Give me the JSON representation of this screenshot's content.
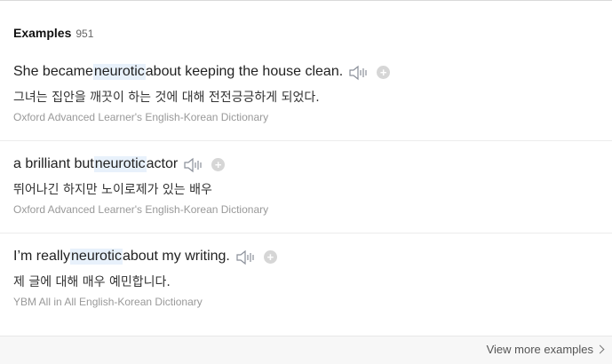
{
  "section": {
    "title": "Examples",
    "count": "951"
  },
  "examples": [
    {
      "before": "She became ",
      "highlight": "neurotic",
      "after": " about keeping the house clean.",
      "translation": "그녀는 집안을 깨끗이 하는 것에 대해 전전긍긍하게 되었다.",
      "source": "Oxford Advanced Learner's English-Korean Dictionary"
    },
    {
      "before": "a brilliant but ",
      "highlight": "neurotic",
      "after": " actor",
      "translation": "뛰어나긴 하지만 노이로제가 있는 배우",
      "source": "Oxford Advanced Learner's English-Korean Dictionary"
    },
    {
      "before": "I’m really ",
      "highlight": "neurotic",
      "after": " about my writing.",
      "translation": "제 글에 대해 매우 예민합니다.",
      "source": "YBM All in All English-Korean Dictionary"
    }
  ],
  "icons": {
    "audio": "speaker-icon",
    "add": "plus-icon",
    "more": "chevron-right-icon"
  },
  "footer": {
    "more_label": "View more examples"
  },
  "colors": {
    "highlight_bg": "#e8f1fb",
    "icon_gray": "#8a8f99",
    "plus_bg": "#d6d6d6"
  }
}
